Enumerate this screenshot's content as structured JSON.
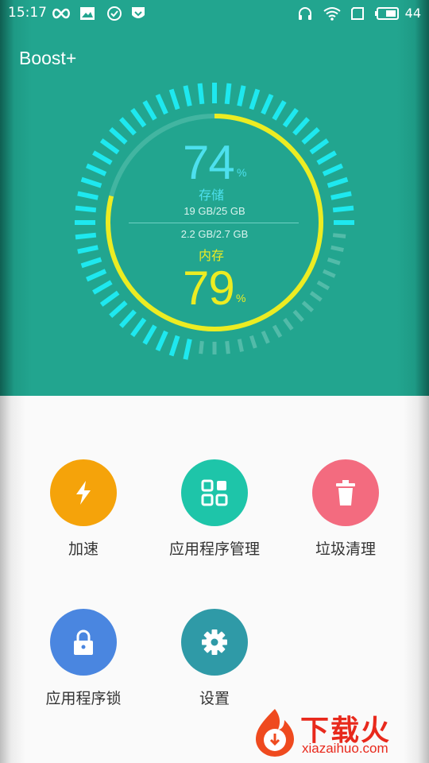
{
  "status_bar": {
    "time": "15:17",
    "battery": "44"
  },
  "app": {
    "title": "Boost+"
  },
  "storage": {
    "percent": "74",
    "percent_sign": "%",
    "label": "存储",
    "used_total": "19 GB/25 GB",
    "fraction": 0.74
  },
  "memory": {
    "percent": "79",
    "percent_sign": "%",
    "label": "内存",
    "used_total": "2.2 GB/2.7 GB",
    "fraction": 0.79
  },
  "tools": [
    {
      "label": "加速",
      "color": "#f5a30a",
      "icon": "lightning-icon"
    },
    {
      "label": "应用程序管理",
      "color": "#1ec5a9",
      "icon": "grid-icon"
    },
    {
      "label": "垃圾清理",
      "color": "#f36b7f",
      "icon": "trash-icon"
    },
    {
      "label": "应用程序锁",
      "color": "#4a86e0",
      "icon": "lock-icon"
    },
    {
      "label": "设置",
      "color": "#2f9aa7",
      "icon": "gear-icon"
    }
  ],
  "watermark": {
    "text": "下载火",
    "sub": "xiazaihuo.com"
  },
  "colors": {
    "header_bg": "#22a58f",
    "storage_accent": "#4de0ee",
    "memory_accent": "#ecec22",
    "page_bg": "#fafafa"
  }
}
